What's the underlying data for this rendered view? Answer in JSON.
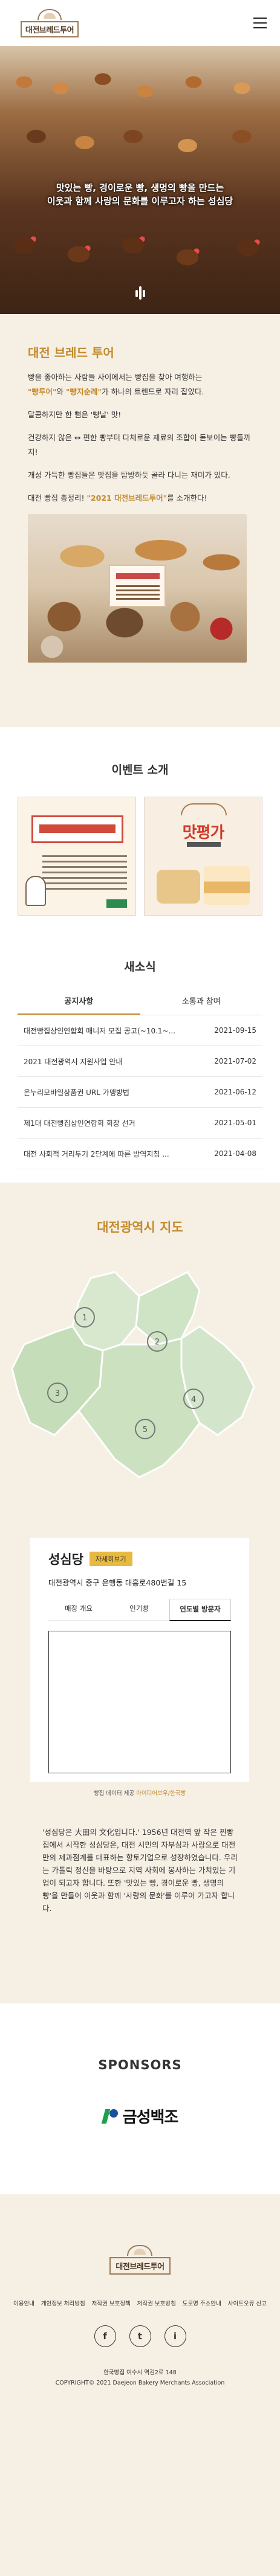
{
  "header": {
    "logo_text": "대전브레드투어",
    "menu_icon": "hamburger-menu-icon"
  },
  "hero": {
    "line1": "맛있는 빵, 경이로운 빵, 생명의 빵을 만드는",
    "line2": "이웃과 함께 사랑의 문화를 이루고자 하는 성심당",
    "icon": "bread-knife-icon"
  },
  "intro": {
    "title": "대전 브레드 투어",
    "p1_hl1": "\"빵투어\"",
    "p1_mid": "와 ",
    "p1_hl2": "\"빵지순례\"",
    "p1_rest": "가 하나의 트렌드로 자리 잡았다.",
    "p1_lead": "빵을 좋아하는 사람들 사이에서는 빵집을 찾아 여행하는",
    "p2": "달콤하지만 한 뼘은 '빵날' 맛!",
    "p3": "건강하지 않은 ↔ 편한 빵부터 다채로운 재료의 조합이 돋보이는 빵들까지!",
    "p4": "개성 가득한 빵집들은 맛집을 탐방하듯 골라 다니는 재미가 있다.",
    "p5_lead": "대전 빵집 총정리! ",
    "p5_hl": "\"2021 대전브레드투어\"",
    "p5_tail": "를 소개한다!"
  },
  "events": {
    "title": "이벤트 소개",
    "card2_title": "맛평가"
  },
  "news": {
    "title": "새소식",
    "tabs": [
      "공지사항",
      "소통과 참여"
    ],
    "items": [
      {
        "title": "대전빵집상인연합회 매니저 모집 공고(~10.1~...",
        "date": "2021-09-15"
      },
      {
        "title": "2021 대전광역시 지원사업 안내",
        "date": "2021-07-02"
      },
      {
        "title": "온누리모바일상품권 URL 가맹방법",
        "date": "2021-06-12"
      },
      {
        "title": "제1대 대전빵집상인연합회 회장 선거",
        "date": "2021-05-01"
      },
      {
        "title": "대전 사회적 거리두기 2단계에 따른 방역지침 ...",
        "date": "2021-04-08"
      }
    ]
  },
  "map": {
    "title": "대전광역시 지도",
    "markers": [
      "1",
      "2",
      "3",
      "4",
      "5"
    ]
  },
  "store": {
    "name": "성심당",
    "detail_button": "자세히보기",
    "address": "대전광역시 중구 은행동 대흥로480번길 15",
    "tabs": [
      "매장 개요",
      "인기빵",
      "연도별 방문자"
    ],
    "map_note_lead": "빵집 데이터 제공 ",
    "map_note_link": "아이디어보우/한국빵"
  },
  "description": {
    "text": "'성심당은 大田의 文化입니다.' 1956년 대전역 앞 작은 찐빵집에서 시작한 성심당은, 대전 시민의 자부심과 사랑으로 대전만의 제과점계를 대표하는 향토기업으로 성장하였습니다. 우리는 가톨릭 정신을 바탕으로 지역 사회에 봉사하는 가치있는 기업이 되고자 합니다. 또한 '맛있는 빵, 경이로운 빵, 생명의 빵'을 만들어 이웃과 함께 '사랑의 문화'를 이루어 가고자 합니다."
  },
  "sponsors": {
    "title": "SPONSORS",
    "sponsor_name": "금성백조"
  },
  "footer": {
    "logo_text": "대전브레드투어",
    "links": [
      "이용안내",
      "개인정보 처리방침",
      "저작권 보호정책",
      "저작권 보호방침",
      "도로명 주소안내",
      "사이트오류 신고"
    ],
    "social": [
      "f",
      "t",
      "i"
    ],
    "address": "한국빵집 여수시 역검2로 148",
    "copyright": "COPYRIGHT© 2021 Daejeon Bakery Merchants Association"
  }
}
